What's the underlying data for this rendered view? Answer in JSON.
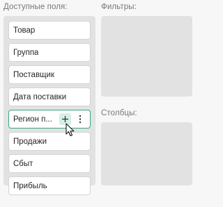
{
  "available_fields": {
    "title": "Доступные поля:",
    "items": [
      {
        "label": "Товар"
      },
      {
        "label": "Группа"
      },
      {
        "label": "Поставщик"
      },
      {
        "label": "Дата поставки"
      },
      {
        "label": "Регион п...",
        "active": true
      },
      {
        "label": "Продажи"
      },
      {
        "label": "Сбыт"
      },
      {
        "label": "Прибыль"
      }
    ]
  },
  "filters": {
    "title": "Фильтры:"
  },
  "columns": {
    "title": "Столбцы:"
  },
  "icons": {
    "add": "plus-icon",
    "more": "more-vertical-icon",
    "cursor": "mouse-pointer-icon"
  },
  "colors": {
    "accent": "#3aa57a",
    "accent_light": "#d4f0e4",
    "panel_bg": "#e2e2e2"
  }
}
